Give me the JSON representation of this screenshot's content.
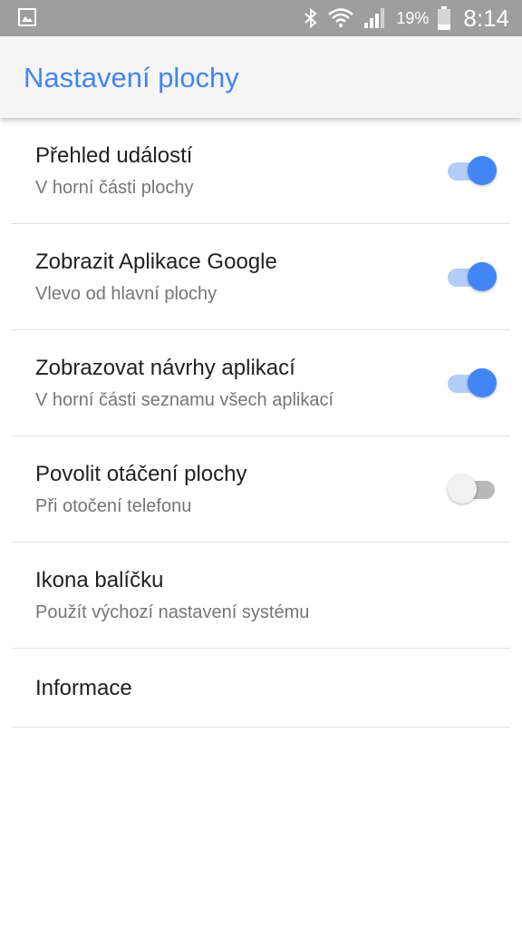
{
  "status_bar": {
    "battery_percent": "19%",
    "time": "8:14"
  },
  "app_bar": {
    "title": "Nastavení plochy"
  },
  "settings": [
    {
      "title": "Přehled událostí",
      "summary": "V horní části plochy",
      "toggle": true
    },
    {
      "title": "Zobrazit Aplikace Google",
      "summary": "Vlevo od hlavní plochy",
      "toggle": true
    },
    {
      "title": "Zobrazovat návrhy aplikací",
      "summary": "V horní části seznamu všech aplikací",
      "toggle": true
    },
    {
      "title": "Povolit otáčení plochy",
      "summary": "Při otočení telefonu",
      "toggle": false
    },
    {
      "title": "Ikona balíčku",
      "summary": "Použít výchozí nastavení systému"
    },
    {
      "title": "Informace"
    }
  ],
  "colors": {
    "accent": "#4285f4",
    "status_bar": "#9e9e9e",
    "toggle_off_track": "#b8b8b8"
  }
}
